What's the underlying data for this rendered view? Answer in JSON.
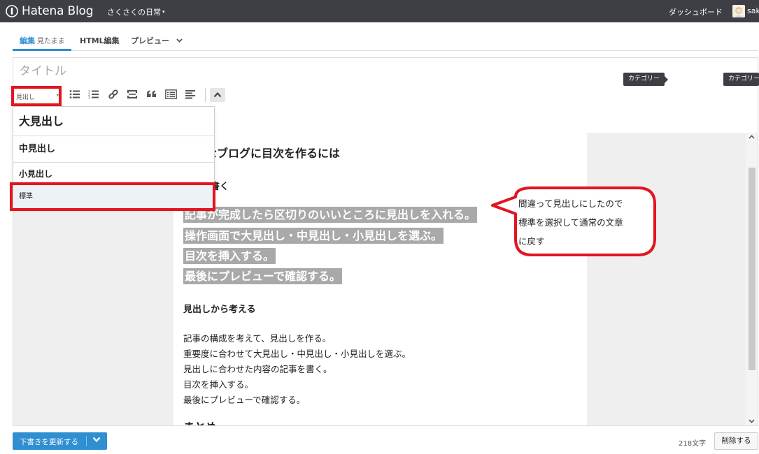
{
  "header": {
    "logo_text": "Hatena Blog",
    "blog_title": "さくさくの日常",
    "blog_title_caret": "▾",
    "dashboard_label": "ダッシュボード",
    "user_name": "sak"
  },
  "tabs": {
    "edit_label": "編集",
    "edit_sub": "見たまま",
    "html_label": "HTML編集",
    "preview_label": "プレビュー",
    "active": "edit"
  },
  "title_field": {
    "placeholder": "タイトル",
    "value": ""
  },
  "toolbar": {
    "heading_select_value": "見出し",
    "heading_select_arrow": "▾",
    "icons": [
      "bullet-list-icon",
      "numbered-list-icon",
      "link-icon",
      "more-break-icon",
      "quote-icon",
      "toc-icon",
      "align-icon",
      "collapse-icon"
    ]
  },
  "category_tips": {
    "tip1": "カテゴリー",
    "tip2": "カテゴリー"
  },
  "heading_dropdown": {
    "h1": "大見出し",
    "h2": "中見出し",
    "h3": "小見出し",
    "normal": "標準",
    "selected": "normal"
  },
  "editor": {
    "main_heading": "はてなブログに目次を作るには",
    "section1_heading": "記事を書く",
    "highlighted_lines": [
      "記事が完成したら区切りのいいところに見出しを入れる。",
      "操作画面で大見出し・中見出し・小見出しを選ぶ。",
      "目次を挿入する。",
      "最後にプレビューで確認する。"
    ],
    "section2_heading": "見出しから考える",
    "body_lines": [
      "記事の構成を考えて、見出しを作る。",
      "重要度に合わせて大見出し・中見出し・小見出しを選ぶ。",
      "見出しに合わせた内容の記事を書く。",
      "目次を挿入する。",
      "最後にプレビューで確認する。"
    ],
    "cutoff_heading": "まとめ"
  },
  "annotation": {
    "lines": [
      "間違って見出しにしたので",
      "標準を選択して通常の文章",
      "に戻す"
    ],
    "highlight_color": "#e3141f"
  },
  "footer": {
    "save_label": "下書きを更新する",
    "char_count": "218文字",
    "delete_label": "削除する"
  },
  "colors": {
    "accent": "#2f8fd1",
    "topbar": "#3d3f44",
    "highlight_bg": "#a9a9a9",
    "annotation_red": "#e3141f"
  }
}
